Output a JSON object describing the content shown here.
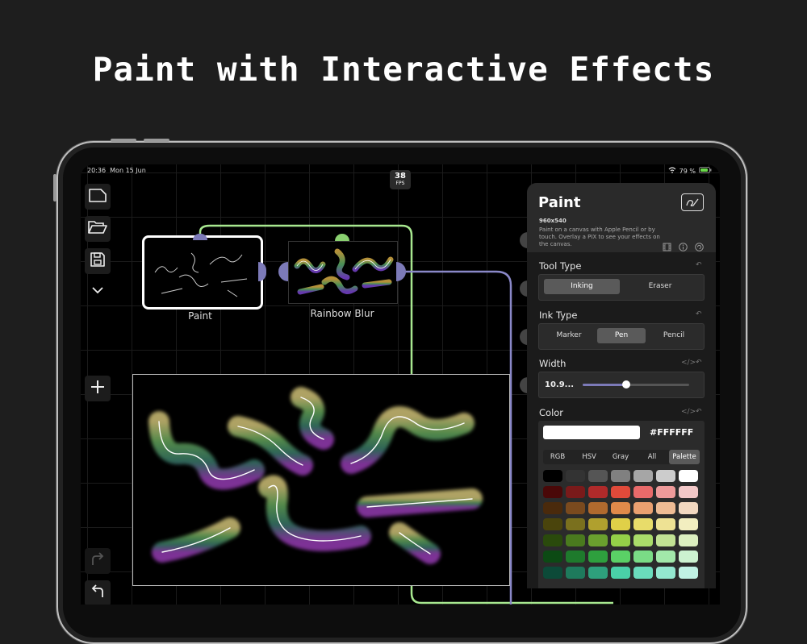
{
  "headline": "Paint with Interactive Effects",
  "status_bar": {
    "time": "20:36",
    "date": "Mon 15 Jun",
    "battery": "79 %"
  },
  "fps": {
    "value": "38",
    "unit": "FPS"
  },
  "nodes": {
    "paint_label": "Paint",
    "rainbow_blur_label": "Rainbow Blur"
  },
  "panel": {
    "title": "Paint",
    "resolution": "960x540",
    "description": "Paint on a canvas with Apple Pencil or by touch. Overlay a PIX to see your effects on the canvas.",
    "tool_type": {
      "label": "Tool Type",
      "options": [
        "Inking",
        "Eraser"
      ],
      "selected": "Inking"
    },
    "ink_type": {
      "label": "Ink Type",
      "options": [
        "Marker",
        "Pen",
        "Pencil"
      ],
      "selected": "Pen"
    },
    "width": {
      "label": "Width",
      "value_text": "10.9...",
      "slider_fraction": 0.41
    },
    "color": {
      "label": "Color",
      "hex": "#FFFFFF",
      "tabs": [
        "RGB",
        "HSV",
        "Gray",
        "All",
        "Palette"
      ],
      "selected_tab": "Palette",
      "palette": [
        [
          "#000000",
          "#333333",
          "#555555",
          "#808080",
          "#a6a6a6",
          "#cccccc",
          "#ffffff"
        ],
        [
          "#4a0808",
          "#7a1a1a",
          "#b02a2a",
          "#e04a3a",
          "#e86a6a",
          "#ee9a9a",
          "#f2c8c8"
        ],
        [
          "#4a2a0c",
          "#7a4a1e",
          "#b06a2e",
          "#e08a4a",
          "#eaa070",
          "#eebb94",
          "#f2d8c0"
        ],
        [
          "#4a440c",
          "#7a701e",
          "#b0a02e",
          "#e0d048",
          "#e8dc6a",
          "#eee294",
          "#f2eec0"
        ],
        [
          "#2a4a0c",
          "#4a7a1e",
          "#6aa02e",
          "#94d048",
          "#aadc6a",
          "#c2e294",
          "#dcefc0"
        ],
        [
          "#0c4a14",
          "#1e7a2c",
          "#2ea03e",
          "#5ad066",
          "#7adc86",
          "#a2e8aa",
          "#ccf2d0"
        ],
        [
          "#0c4a38",
          "#1e7a5c",
          "#2ea07c",
          "#4ad0a8",
          "#6adcbc",
          "#94e8d0",
          "#c0f2e4"
        ]
      ]
    }
  },
  "colors": {
    "green_wire": "#a8e890",
    "purple_wire": "#8a88c8",
    "accent": "#7c7ab8",
    "panel_bg": "#1b1b1b"
  }
}
